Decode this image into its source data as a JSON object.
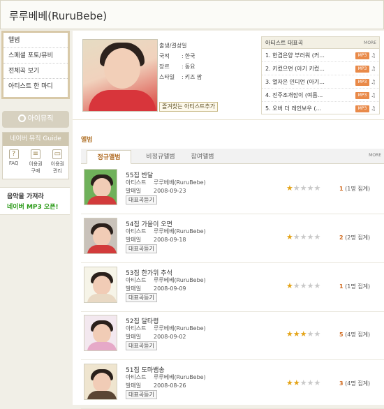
{
  "header": {
    "title": "루루베베(RuruBebe)"
  },
  "left_menu": {
    "items": [
      {
        "label": "앨범"
      },
      {
        "label": "스페셜 포토/뮤비"
      },
      {
        "label": "전체곡 보기"
      },
      {
        "label": "아티스트 한 마디"
      }
    ]
  },
  "imusic": {
    "label": "아이뮤직"
  },
  "guide": {
    "title": "네이버 뮤직 Guide",
    "items": [
      {
        "label": "FAQ",
        "icon": "question-icon"
      },
      {
        "label": "이용권\n구매",
        "icon": "ticket-icon"
      },
      {
        "label": "이용권\n관리",
        "icon": "card-icon"
      }
    ]
  },
  "mp3_banner": {
    "line1": "음악을 가져라",
    "line2": "네이버 MP3 오픈!"
  },
  "profile": {
    "rows": [
      {
        "label": "출생/결성일",
        "value": ""
      },
      {
        "label": "국적",
        "value": "한국"
      },
      {
        "label": "장르",
        "value": "동요"
      },
      {
        "label": "스타일",
        "value": "키즈 팝"
      }
    ],
    "favorite_button": "즐겨찾는 아티스트추가"
  },
  "top_songs": {
    "title": "아티스트 대표곡",
    "more": "MORE",
    "mp3_label": "MP3",
    "songs": [
      {
        "text": "1. 한겹은양 부러워 (커..."
      },
      {
        "text": "2. 키컸으면 (아기 키컸..."
      },
      {
        "text": "3. 열자은 인디언 (아기..."
      },
      {
        "text": "4. 진주조개잡이 (여름..."
      },
      {
        "text": "5. 오버 더 레인보우 (..."
      }
    ]
  },
  "albums": {
    "section_title": "앨범",
    "tabs": [
      "정규앨범",
      "비정규앨범",
      "참여앨범"
    ],
    "more": "MORE",
    "artist_label": "아티스트",
    "date_label": "발매일",
    "listen_label": "대표곡듣기",
    "list": [
      {
        "title": "55집 반달",
        "artist": "루루베베(RuruBebe)",
        "date": "2008-09-23",
        "stars": 0.5,
        "rating": "1",
        "count": "(1명 집계)",
        "shirt": "#d23b3b",
        "bg": "#6fb15a"
      },
      {
        "title": "54집 가을이 오면",
        "artist": "루루베베(RuruBebe)",
        "date": "2008-09-18",
        "stars": 1,
        "rating": "2",
        "count": "(2명 집계)",
        "shirt": "#d23b3b",
        "bg": "#c9c2ba"
      },
      {
        "title": "53집 한가위 추석",
        "artist": "루루베베(RuruBebe)",
        "date": "2008-09-09",
        "stars": 0.5,
        "rating": "1",
        "count": "(1명 집계)",
        "shirt": "#e9d9c4",
        "bg": "#f6f4e8"
      },
      {
        "title": "52집 달타령",
        "artist": "루루베베(RuruBebe)",
        "date": "2008-09-02",
        "stars": 2.5,
        "rating": "5",
        "count": "(4명 집계)",
        "shirt": "#e6a9c8",
        "bg": "#f3e8ef"
      },
      {
        "title": "51집 도마뱀송",
        "artist": "루루베베(RuruBebe)",
        "date": "2008-08-26",
        "stars": 1.5,
        "rating": "3",
        "count": "(4명 집계)",
        "shirt": "#5a4634",
        "bg": "#efe5cf"
      }
    ]
  }
}
